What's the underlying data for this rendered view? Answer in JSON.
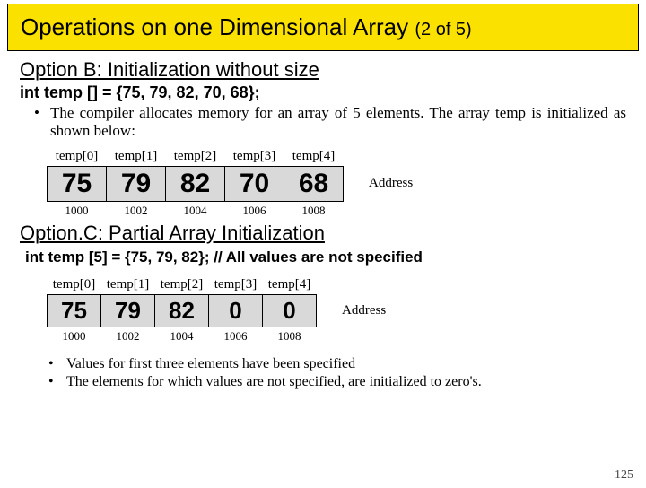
{
  "title": {
    "main": "Operations on one Dimensional Array ",
    "paren": "(2 of 5)"
  },
  "optionB": {
    "heading": "Option B: Initialization without size",
    "code": "int temp [] = {75, 79, 82, 70, 68};",
    "bullet": "The compiler allocates memory for an array of 5 elements. The array temp is initialized as shown below:",
    "labels": [
      "temp[0]",
      "temp[1]",
      "temp[2]",
      "temp[3]",
      "temp[4]"
    ],
    "values": [
      "75",
      "79",
      "82",
      "70",
      "68"
    ],
    "addrs": [
      "1000",
      "1002",
      "1004",
      "1006",
      "1008"
    ],
    "addrLabel": "Address"
  },
  "optionC": {
    "heading": "Option.C: Partial Array Initialization",
    "code": "int temp [5] = {75, 79, 82};  // All values are not specified",
    "labels": [
      "temp[0]",
      "temp[1]",
      "temp[2]",
      "temp[3]",
      "temp[4]"
    ],
    "values": [
      "75",
      "79",
      "82",
      "0",
      "0"
    ],
    "addrs": [
      "1000",
      "1002",
      "1004",
      "1006",
      "1008"
    ],
    "addrLabel": "Address",
    "bullets": [
      "Values for first three elements have been specified",
      "The elements for which values are not specified, are initialized to zero's."
    ]
  },
  "slideNum": "125",
  "chart_data": [
    {
      "type": "table",
      "title": "temp array (Option B)",
      "categories": [
        "temp[0]",
        "temp[1]",
        "temp[2]",
        "temp[3]",
        "temp[4]"
      ],
      "values": [
        75,
        79,
        82,
        70,
        68
      ],
      "addresses": [
        1000,
        1002,
        1004,
        1006,
        1008
      ]
    },
    {
      "type": "table",
      "title": "temp array (Option C)",
      "categories": [
        "temp[0]",
        "temp[1]",
        "temp[2]",
        "temp[3]",
        "temp[4]"
      ],
      "values": [
        75,
        79,
        82,
        0,
        0
      ],
      "addresses": [
        1000,
        1002,
        1004,
        1006,
        1008
      ]
    }
  ]
}
